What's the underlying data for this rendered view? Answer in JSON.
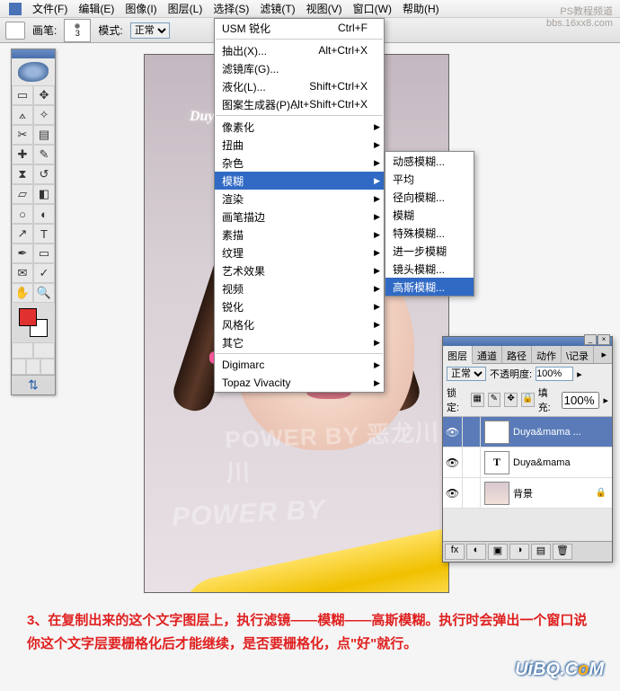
{
  "menubar": [
    "文件(F)",
    "编辑(E)",
    "图像(I)",
    "图层(L)",
    "选择(S)",
    "滤镜(T)",
    "视图(V)",
    "窗口(W)",
    "帮助(H)"
  ],
  "menubar_ukeys": [
    "F",
    "E",
    "I",
    "L",
    "S",
    "T",
    "V",
    "W",
    "H"
  ],
  "optbar": {
    "brush_label": "画笔:",
    "brush_size": "3",
    "mode_label": "模式:",
    "mode_value": "正常"
  },
  "filter_menu": {
    "last": {
      "label": "USM 锐化",
      "shortcut": "Ctrl+F"
    },
    "group1": [
      {
        "label": "抽出(X)...",
        "shortcut": "Alt+Ctrl+X"
      },
      {
        "label": "滤镜库(G)...",
        "shortcut": ""
      },
      {
        "label": "液化(L)...",
        "shortcut": "Shift+Ctrl+X"
      },
      {
        "label": "图案生成器(P)...",
        "shortcut": "Alt+Shift+Ctrl+X"
      }
    ],
    "group2": [
      {
        "label": "像素化",
        "sub": true
      },
      {
        "label": "扭曲",
        "sub": true
      },
      {
        "label": "杂色",
        "sub": true
      },
      {
        "label": "模糊",
        "sub": true,
        "selected": true
      },
      {
        "label": "渲染",
        "sub": true
      },
      {
        "label": "画笔描边",
        "sub": true
      },
      {
        "label": "素描",
        "sub": true
      },
      {
        "label": "纹理",
        "sub": true
      },
      {
        "label": "艺术效果",
        "sub": true
      },
      {
        "label": "视频",
        "sub": true
      },
      {
        "label": "锐化",
        "sub": true
      },
      {
        "label": "风格化",
        "sub": true
      },
      {
        "label": "其它",
        "sub": true
      }
    ],
    "group3": [
      {
        "label": "Digimarc",
        "sub": true
      },
      {
        "label": "Topaz Vivacity",
        "sub": true
      }
    ]
  },
  "blur_submenu": [
    {
      "label": "动感模糊..."
    },
    {
      "label": "平均"
    },
    {
      "label": "径向模糊..."
    },
    {
      "label": "模糊"
    },
    {
      "label": "特殊模糊..."
    },
    {
      "label": "进一步模糊"
    },
    {
      "label": "镜头模糊..."
    },
    {
      "label": "高斯模糊...",
      "selected": true
    }
  ],
  "canvas_text": {
    "duya": "Duya",
    "wm_line1": "POWER BY 恶龙川川",
    "wm_line2": "POWER BY"
  },
  "top_watermark": {
    "l1": "PS教程频道",
    "l2": "bbs.16xx8.com"
  },
  "layers_panel": {
    "tabs": [
      "图层",
      "通道",
      "路径",
      "动作",
      "\\记录"
    ],
    "blend": "正常",
    "opacity_label": "不透明度:",
    "opacity": "100%",
    "lock_label": "锁定:",
    "fill_label": "填充:",
    "fill": "100%",
    "layers": [
      {
        "name": "Duya&mama ...",
        "type": "T",
        "selected": true
      },
      {
        "name": "Duya&mama",
        "type": "T"
      },
      {
        "name": "背景",
        "type": "bg",
        "locked": true
      }
    ]
  },
  "caption": "3、在复制出来的这个文字图层上，执行滤镜——模糊——高斯模糊。执行时会弹出一个窗口说你这个文字层要栅格化后才能继续，是否要栅格化，点\"好\"就行。",
  "footer_logo": "UiBQ.CoM"
}
